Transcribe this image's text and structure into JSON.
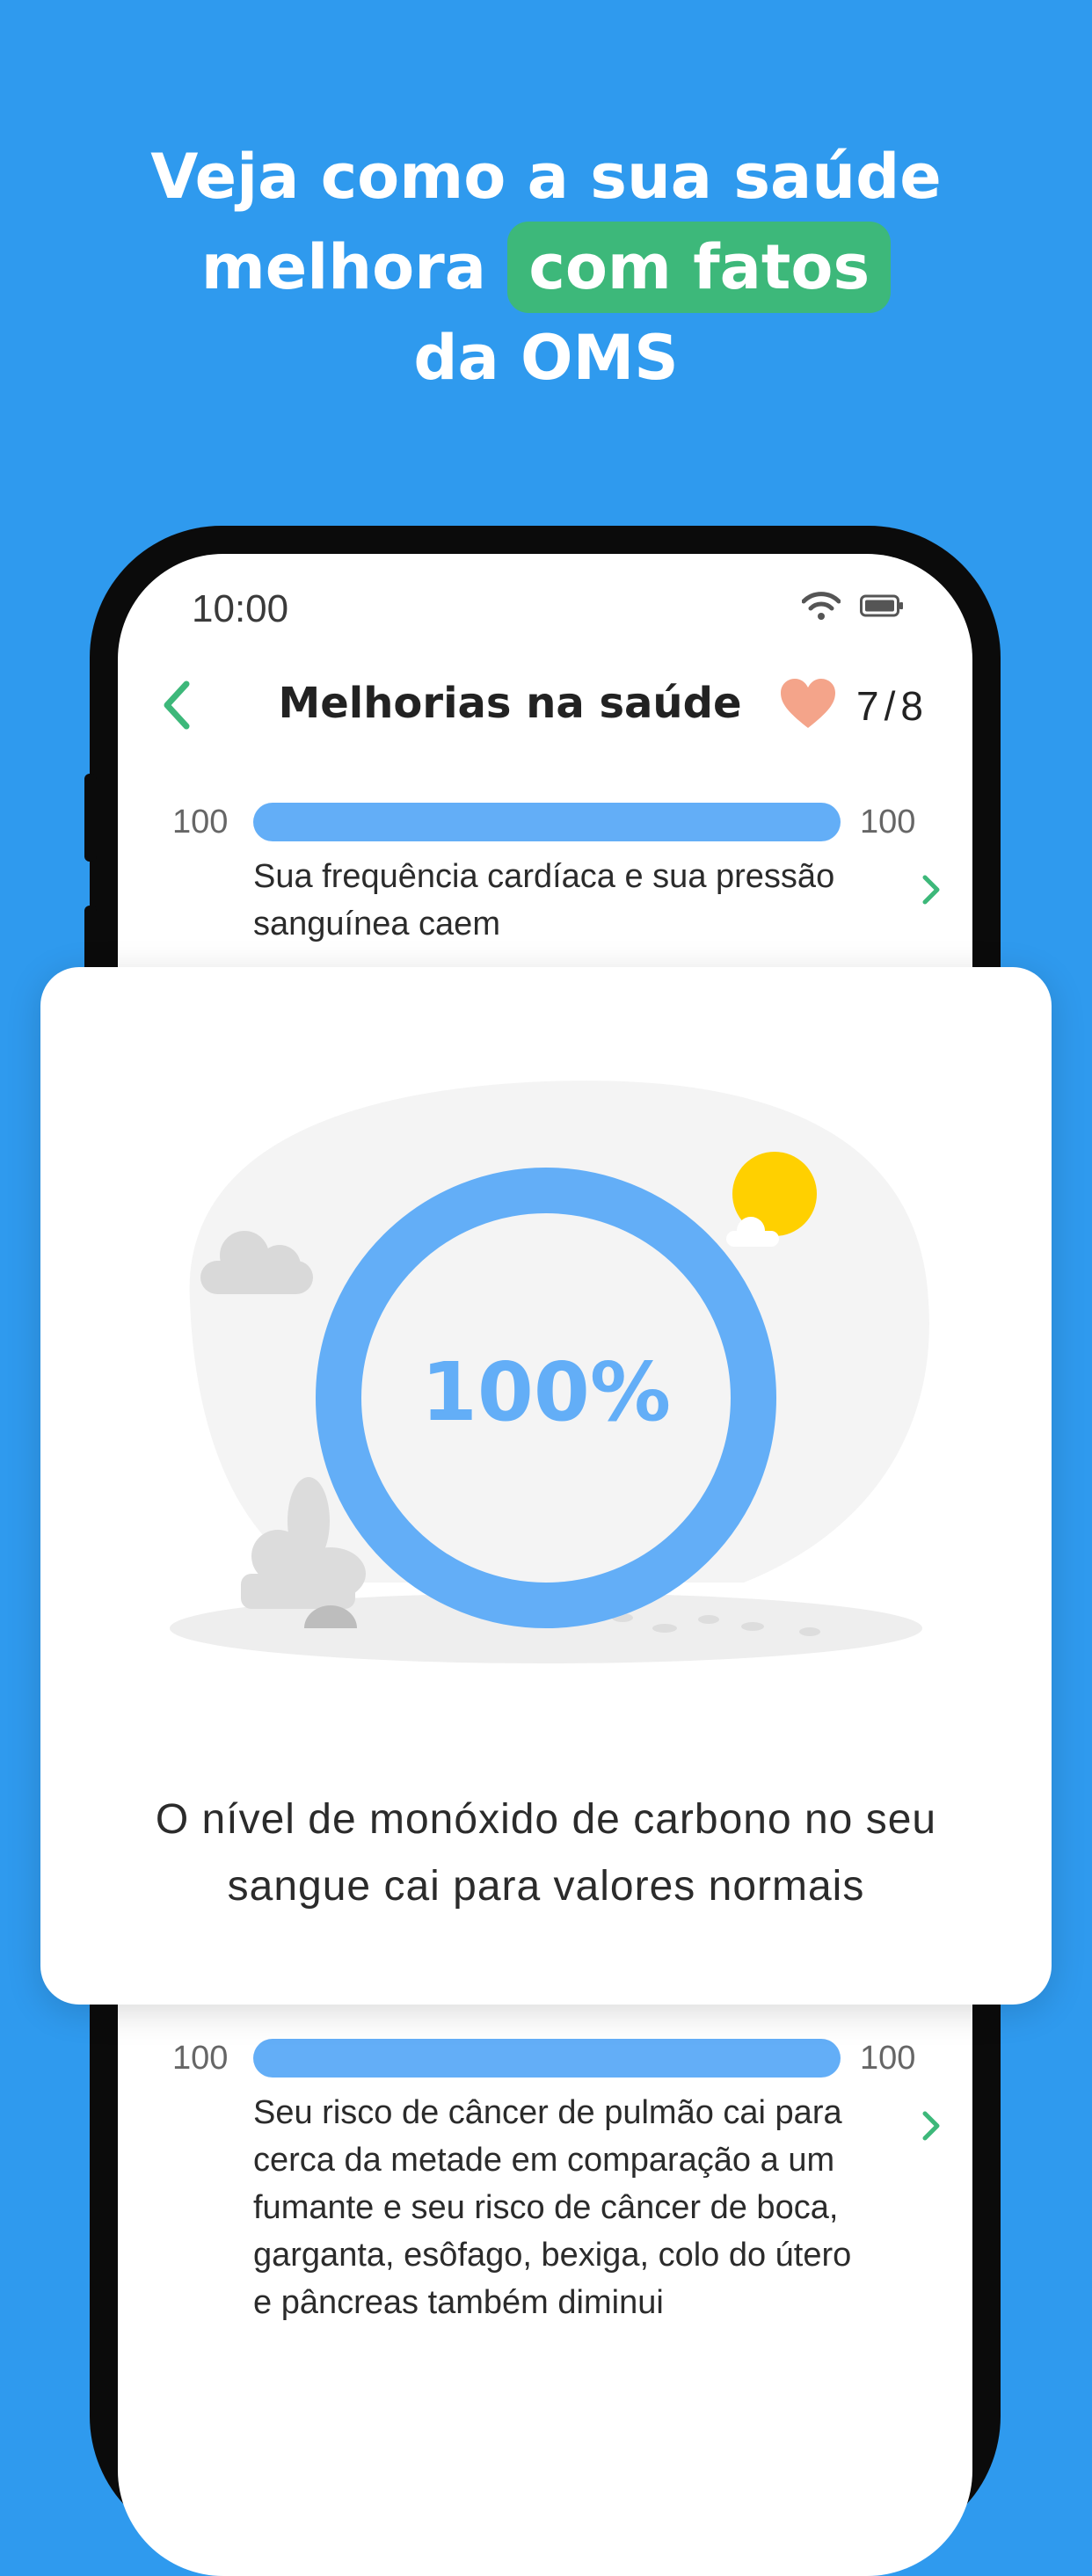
{
  "headline": {
    "line1": "Veja como a sua saúde",
    "line2_before": "melhora",
    "line2_highlight": "com fatos",
    "line3": "da OMS"
  },
  "status_bar": {
    "time": "10:00"
  },
  "nav": {
    "title": "Melhorias na saúde",
    "count_done": "7",
    "count_sep": "/",
    "count_total": "8"
  },
  "rows": [
    {
      "left": "100",
      "right": "100",
      "progress": 1.0,
      "text": "Sua frequência cardíaca e sua pressão sanguínea caem"
    },
    {
      "left": "100",
      "right": "100",
      "progress": 1.0,
      "text": "Seu risco de câncer de pulmão cai para cerca da metade em comparação a um fumante e seu risco de câncer de boca, garganta, esôfago, bexiga, colo do útero e pâncreas também diminui"
    }
  ],
  "card": {
    "percent": "100%",
    "progress": 1.0,
    "text": "O nível de monóxido de carbono no seu sangue cai para valores normais"
  },
  "colors": {
    "background": "#2f9aee",
    "highlight": "#3db87a",
    "progress": "#63aef7",
    "heart": "#f4a48a",
    "sun": "#ffd000",
    "chevron": "#3db87a"
  }
}
